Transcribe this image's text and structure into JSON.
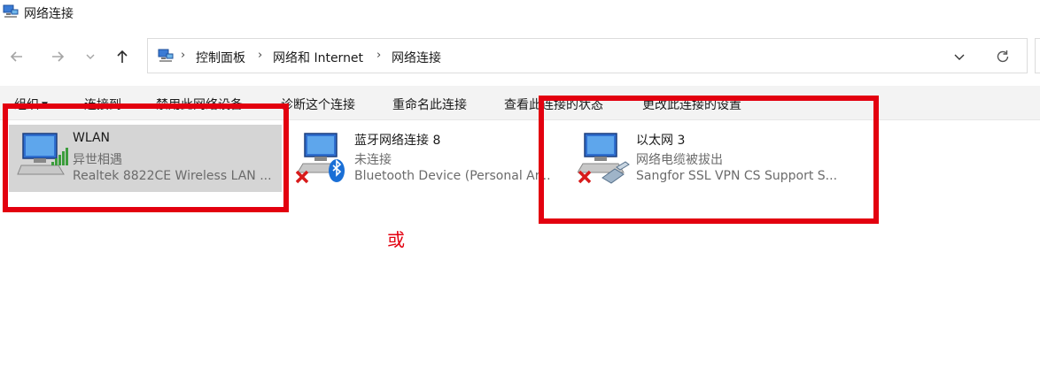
{
  "window": {
    "title": "网络连接"
  },
  "nav": {
    "back_icon": "arrow-left-icon",
    "forward_icon": "arrow-right-icon",
    "recent_icon": "chevron-down-icon",
    "up_icon": "arrow-up-icon"
  },
  "address": {
    "icon": "control-panel-icon",
    "crumbs": [
      "控制面板",
      "网络和 Internet",
      "网络连接"
    ],
    "separator": "›"
  },
  "commands": {
    "organize": "组织",
    "connect_to": "连接到",
    "disable": "禁用此网络设备",
    "diagnose": "诊断这个连接",
    "rename": "重命名此连接",
    "view_status": "查看此连接的状态",
    "change_settings": "更改此连接的设置"
  },
  "connections": [
    {
      "name": "WLAN",
      "status": "异世相遇",
      "device": "Realtek 8822CE Wireless LAN ...",
      "icon": "wifi-adapter-icon",
      "selected": true
    },
    {
      "name": "蓝牙网络连接 8",
      "status": "未连接",
      "device": "Bluetooth Device (Personal Ar...",
      "icon": "bluetooth-adapter-icon",
      "selected": false
    },
    {
      "name": "以太网 3",
      "status": "网络电缆被拔出",
      "device": "Sangfor SSL VPN CS Support S...",
      "icon": "ethernet-adapter-icon",
      "selected": false
    }
  ],
  "annotation": {
    "or_text": "或",
    "color": "#e3000f"
  }
}
